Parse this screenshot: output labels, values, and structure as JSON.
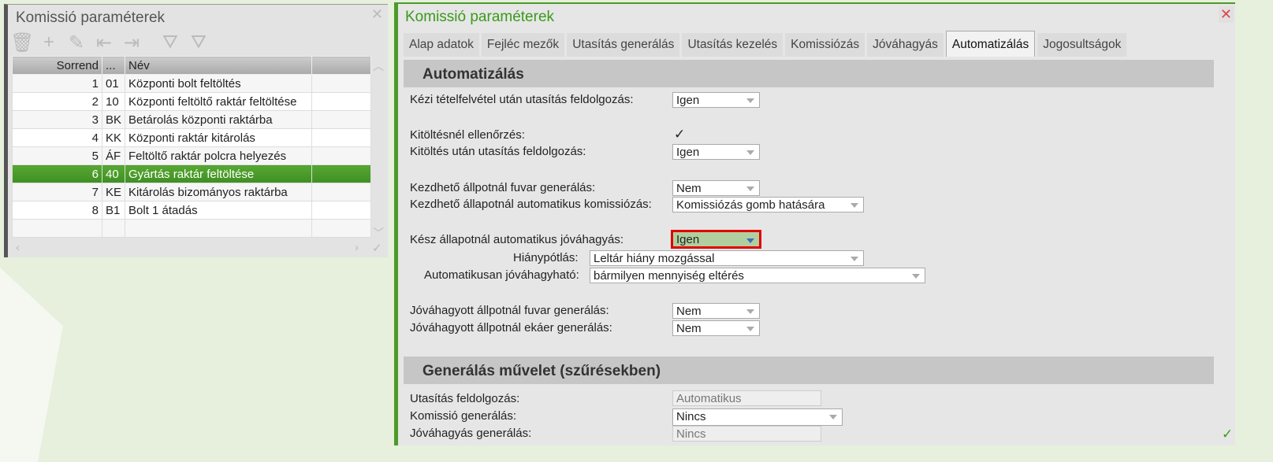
{
  "left_window": {
    "title": "Komissió paraméterek",
    "columns": [
      "Sorrend",
      "...",
      "Név",
      ""
    ],
    "rows": [
      {
        "order": "1",
        "code": "01",
        "name": "Központi bolt feltöltés"
      },
      {
        "order": "2",
        "code": "10",
        "name": "Központi feltöltő raktár feltöltése"
      },
      {
        "order": "3",
        "code": "BK",
        "name": "Betárolás központi raktárba"
      },
      {
        "order": "4",
        "code": "KK",
        "name": "Központi raktár kitárolás"
      },
      {
        "order": "5",
        "code": "ÁF",
        "name": "Feltöltő raktár polcra helyezés"
      },
      {
        "order": "6",
        "code": "40",
        "name": "Gyártás raktár feltöltése"
      },
      {
        "order": "7",
        "code": "KE",
        "name": "Kitárolás bizományos raktárba"
      },
      {
        "order": "8",
        "code": "B1",
        "name": "Bolt 1 átadás"
      }
    ],
    "selected_row": 6
  },
  "right_window": {
    "title": "Komissió paraméterek",
    "tabs": [
      "Alap adatok",
      "Fejléc mezők",
      "Utasítás generálás",
      "Utasítás kezelés",
      "Komissiózás",
      "Jóváhagyás",
      "Automatizálás",
      "Jogosultságok"
    ],
    "active_tab": "Automatizálás",
    "section1": {
      "title": "Automatizálás",
      "fields": [
        {
          "label": "Kézi tételfelvétel után utasítás feldolgozás:",
          "value": "Igen"
        },
        {
          "label": "Kitöltésnél ellenőrzés:",
          "value": "✓"
        },
        {
          "label": "Kitöltés után utasítás feldolgozás:",
          "value": "Igen"
        },
        {
          "label": "Kezdhető állpotnál fuvar generálás:",
          "value": "Nem"
        },
        {
          "label": "Kezdhető állapotnál automatikus komissiózás:",
          "value": "Komissiózás gomb hatására"
        },
        {
          "label": "Kész állapotnál automatikus jóváhagyás:",
          "value": "Igen"
        },
        {
          "label": "Hiánypótlás:",
          "value": "Leltár hiány mozgással"
        },
        {
          "label": "Automatikusan jóváhagyható:",
          "value": "bármilyen mennyiség eltérés"
        },
        {
          "label": "Jóváhagyott állpotnál fuvar generálás:",
          "value": "Nem"
        },
        {
          "label": "Jóváhagyott állpotnál ekáer generálás:",
          "value": "Nem"
        }
      ]
    },
    "section2": {
      "title": "Generálás művelet (szűrésekben)",
      "fields": [
        {
          "label": "Utasítás feldolgozás:",
          "value": "Automatikus"
        },
        {
          "label": "Komissió generálás:",
          "value": "Nincs"
        },
        {
          "label": "Jóváhagyás generálás:",
          "value": "Nincs"
        }
      ]
    }
  },
  "colors": {
    "accent": "#4c9a2a",
    "highlight": "#e00000"
  }
}
